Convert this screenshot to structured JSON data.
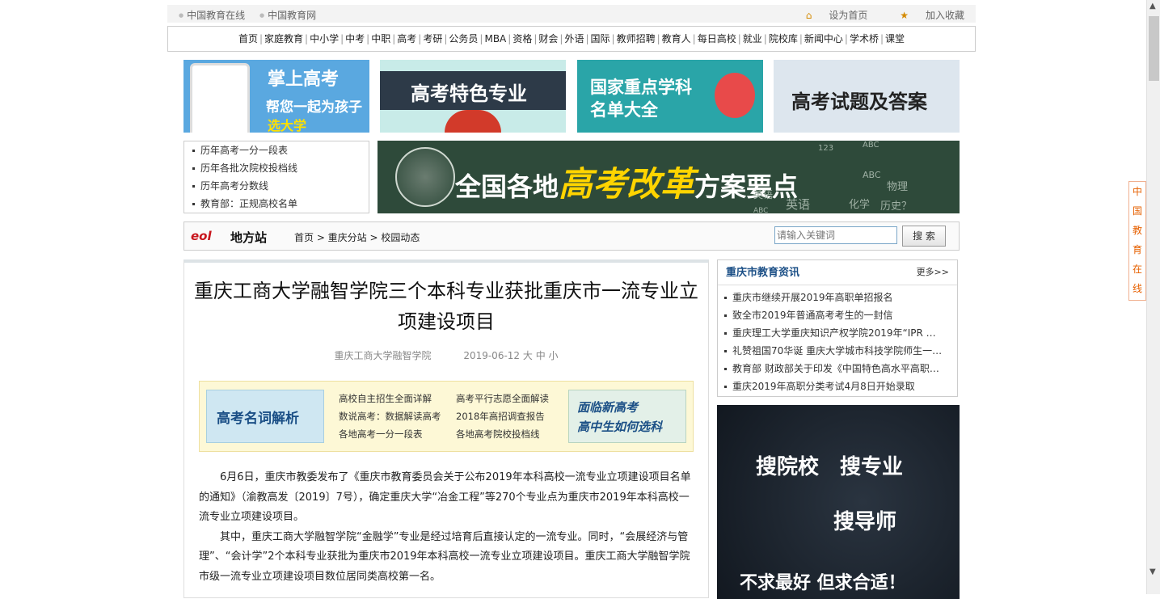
{
  "topbar": {
    "links": [
      "中国教育在线",
      "中国教育网"
    ],
    "set_home": "设为首页",
    "add_fav": "加入收藏"
  },
  "nav": [
    "首页",
    "家庭教育",
    "中小学",
    "中考",
    "中职",
    "高考",
    "考研",
    "公务员",
    "MBA",
    "资格",
    "财会",
    "外语",
    "国际",
    "教师招聘",
    "教育人",
    "每日高校",
    "就业",
    "院校库",
    "新闻中心",
    "学术桥",
    "课堂"
  ],
  "banners": {
    "b1_line1": "掌上高考",
    "b1_line2": "帮您一起为孩子",
    "b1_line3": "选大学",
    "b2": "高考特色专业",
    "b3_line1": "国家重点学科",
    "b3_line2": "名单大全",
    "b4": "高考试题及答案"
  },
  "quick_list": [
    "历年高考一分一段表",
    "历年各批次院校投档线",
    "历年高考分数线",
    "教育部：正规高校名单"
  ],
  "reform": {
    "pre": "全国各地",
    "mid": "高考改革",
    "post": "方案要点"
  },
  "reform_deco": [
    "123",
    "ABC",
    "物理",
    "英语",
    "化学",
    "历史？",
    "ABC",
    "英语",
    "ABC"
  ],
  "searchbar": {
    "logo": "eol",
    "station": "地方站",
    "crumb": "首页 > 重庆分站 > 校园动态",
    "placeholder": "请输入关键词",
    "button": "搜 索"
  },
  "article": {
    "title": "重庆工商大学融智学院三个本科专业获批重庆市一流专业立项建设项目",
    "source": "重庆工商大学融智学院",
    "date": "2019-06-12",
    "sizes": "大 中 小",
    "promo_left": "高考名词解析",
    "promo_links": [
      "高校自主招生全面详解",
      "高考平行志愿全面解读",
      "数说高考：数据解读高考",
      "2018年高招调查报告",
      "各地高考一分一段表",
      "各地高考院校投档线"
    ],
    "promo_right_line1": "面临新高考",
    "promo_right_line2": "高中生如何选科",
    "p1": "6月6日，重庆市教委发布了《重庆市教育委员会关于公布2019年本科高校一流专业立项建设项目名单的通知》（渝教高发〔2019〕7号），确定重庆大学“冶金工程”等270个专业点为重庆市2019年本科高校一流专业立项建设项目。",
    "p2": "其中，重庆工商大学融智学院“金融学”专业是经过培育后直接认定的一流专业。同时，“会展经济与管理”、“会计学”2个本科专业获批为重庆市2019年本科高校一流专业立项建设项目。重庆工商大学融智学院市级一流专业立项建设项目数位居同类高校第一名。"
  },
  "news": {
    "title": "重庆市教育资讯",
    "more": "更多>>",
    "items": [
      "重庆市继续开展2019年高职单招报名",
      "致全市2019年普通高考考生的一封信",
      "重庆理工大学重庆知识产权学院2019年“IPR …",
      "礼赞祖国70华诞 重庆大学城市科技学院师生一…",
      "教育部 财政部关于印发《中国特色高水平高职…",
      "重庆2019年高职分类考试4月8日开始录取"
    ]
  },
  "ad": {
    "line1": "搜院校",
    "line2": "搜专业",
    "line3": "搜导师",
    "line4": "不求最好 但求合适！"
  },
  "sidetab": [
    "中",
    "国",
    "教",
    "育",
    "在",
    "线"
  ],
  "colors": {
    "accent": "#1b4f86",
    "orange": "#e66000",
    "banner_yellow": "#ffe000"
  }
}
